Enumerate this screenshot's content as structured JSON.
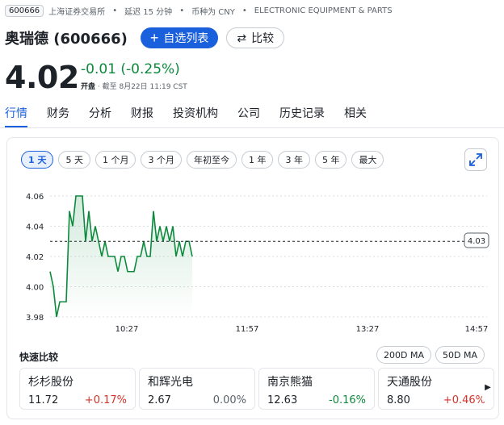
{
  "ticker": {
    "code": "600666",
    "exchange": "上海证券交易所",
    "delay": "延迟 15 分钟",
    "currency": "币种为 CNY",
    "sector": "ELECTRONIC EQUIPMENT & PARTS"
  },
  "title": "奥瑞德 (600666)",
  "watch_label": "自选列表",
  "compare_label": "比较",
  "price": "4.02",
  "change": "-0.01 (-0.25%)",
  "status": "开盘",
  "as_of": "截至 8月22日 11:19 CST",
  "tabs": [
    "行情",
    "财务",
    "分析",
    "财报",
    "投资机构",
    "公司",
    "历史记录",
    "相关"
  ],
  "ranges": [
    "1 天",
    "5 天",
    "1 个月",
    "3 个月",
    "年初至今",
    "1 年",
    "3 年",
    "5 年",
    "最大"
  ],
  "prev_close_label": "4.03",
  "quick_compare": "快速比较",
  "ma": [
    "200D MA",
    "50D MA"
  ],
  "compare_items": [
    {
      "name": "杉杉股份",
      "price": "11.72",
      "change": "+0.17%",
      "dir": "pos"
    },
    {
      "name": "和辉光电",
      "price": "2.67",
      "change": "0.00%",
      "dir": "zero"
    },
    {
      "name": "南京熊猫",
      "price": "12.63",
      "change": "-0.16%",
      "dir": "neg"
    },
    {
      "name": "天通股份",
      "price": "8.80",
      "change": "+0.46%",
      "dir": "pos"
    }
  ],
  "colors": {
    "accent": "#1a5fdc",
    "down": "#0c8a3c",
    "up": "#d6322a"
  },
  "chart_data": {
    "type": "line",
    "y_ticks": [
      "4.06",
      "4.04",
      "4.02",
      "4.00",
      "3.98"
    ],
    "x_ticks": [
      "10:27",
      "11:57",
      "13:27",
      "14:57"
    ],
    "ylim": [
      3.98,
      4.06
    ],
    "reference_line": 4.03,
    "series": [
      {
        "values": [
          4.01,
          4.0,
          3.98,
          3.99,
          3.99,
          3.99,
          4.05,
          4.04,
          4.06,
          4.06,
          4.06,
          4.03,
          4.05,
          4.03,
          4.04,
          4.03,
          4.02,
          4.03,
          4.02,
          4.02,
          4.02,
          4.01,
          4.02,
          4.02,
          4.01,
          4.01,
          4.01,
          4.02,
          4.02,
          4.03,
          4.02,
          4.02,
          4.05,
          4.03,
          4.04,
          4.03,
          4.04,
          4.03,
          4.04,
          4.02,
          4.03,
          4.02,
          4.03,
          4.03,
          4.02
        ]
      }
    ]
  }
}
